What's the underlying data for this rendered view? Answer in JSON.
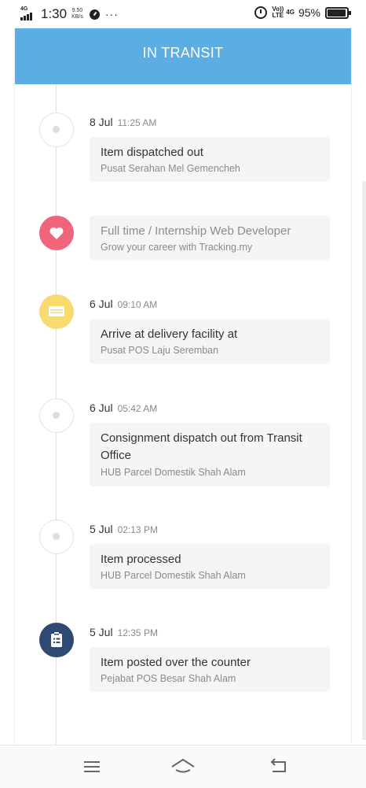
{
  "status_bar": {
    "network_tag": "4G",
    "time": "1:30",
    "speed_value": "9.50",
    "speed_unit": "KB/s",
    "more": "···",
    "volte_top": "Vo))",
    "volte_bottom": "LTE",
    "net": "4G",
    "battery_percent": "95%",
    "battery_level": 0.95
  },
  "header": {
    "title": "IN TRANSIT",
    "color": "#5aaee3"
  },
  "timeline": [
    {
      "type": "event",
      "icon": "dot-icon",
      "date": "8 Jul",
      "time": "11:25 AM",
      "title": "Item dispatched out",
      "location": "Pusat Serahan Mel Gemencheh"
    },
    {
      "type": "ad",
      "icon": "heart-icon",
      "title": "Full time / Internship Web Developer",
      "subtitle": "Grow your career with Tracking.my",
      "color": "#f0657a"
    },
    {
      "type": "event",
      "icon": "truck-icon",
      "date": "6 Jul",
      "time": "09:10 AM",
      "title": "Arrive at delivery facility at",
      "location": "Pusat POS Laju Seremban",
      "color": "#f7db70"
    },
    {
      "type": "event",
      "icon": "dot-icon",
      "date": "6 Jul",
      "time": "05:42 AM",
      "title_line1": "Consignment dispatch out from Transit",
      "title_line2": "Office",
      "location": "HUB Parcel Domestik Shah Alam"
    },
    {
      "type": "event",
      "icon": "dot-icon",
      "date": "5 Jul",
      "time": "02:13 PM",
      "title": "Item processed",
      "location": "HUB Parcel Domestik Shah Alam"
    },
    {
      "type": "event",
      "icon": "clipboard-icon",
      "date": "5 Jul",
      "time": "12:35 PM",
      "title": "Item posted over the counter",
      "location": "Pejabat POS Besar Shah Alam",
      "color": "#2e4a73"
    }
  ],
  "nav": {
    "menu": "menu-icon",
    "home": "home-icon",
    "back": "back-icon"
  }
}
